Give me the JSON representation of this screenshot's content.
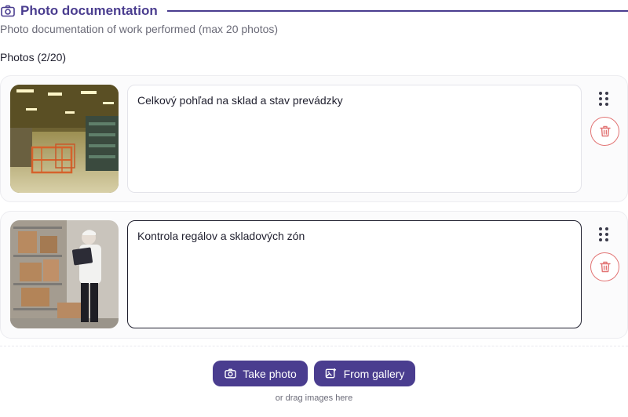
{
  "section": {
    "icon": "camera-icon",
    "title": "Photo documentation",
    "subtitle": "Photo documentation of work performed (max 20 photos)",
    "accent_color": "#4a3d8f"
  },
  "photos": {
    "label": "Photos (2/20)",
    "items": [
      {
        "description": "Celkový pohľad na sklad a stav prevádzky",
        "image": "warehouse-interior-photo"
      },
      {
        "description": "Kontrola regálov a skladových zón",
        "image": "worker-with-clipboard-photo"
      }
    ]
  },
  "actions": {
    "take_photo_label": "Take photo",
    "from_gallery_label": "From gallery",
    "drag_hint": "or drag images here",
    "delete_color": "#e27474"
  }
}
